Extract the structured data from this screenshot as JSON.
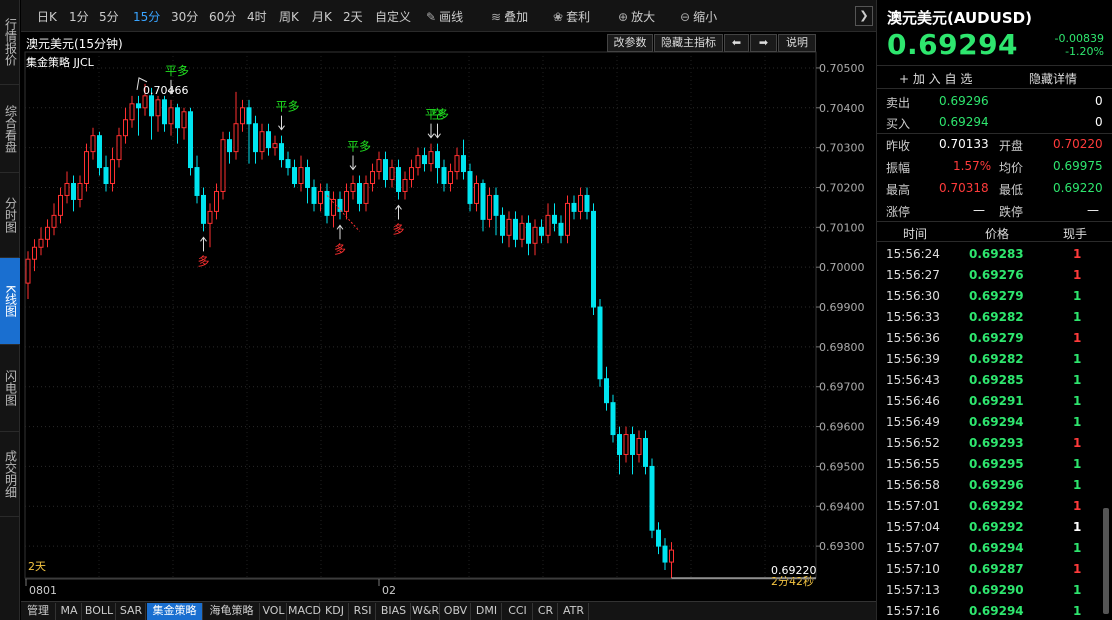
{
  "left_nav": [
    {
      "label": "行情报价",
      "active": false
    },
    {
      "label": "综合看盘",
      "active": false
    },
    {
      "label": "分时图",
      "active": false
    },
    {
      "label": "K线图",
      "active": true
    },
    {
      "label": "闪电图",
      "active": false
    },
    {
      "label": "成交明细",
      "active": false
    }
  ],
  "toolbar": {
    "periods": [
      "日K",
      "1分",
      "5分",
      "15分",
      "30分",
      "60分",
      "4时",
      "周K",
      "月K",
      "2天",
      "自定义"
    ],
    "active_period": "15分",
    "tools": [
      {
        "label": "画线",
        "icon": "pencil-icon",
        "glyph": "✎"
      },
      {
        "label": "叠加",
        "icon": "layers-icon",
        "glyph": "≋"
      },
      {
        "label": "套利",
        "icon": "bag-icon",
        "glyph": "❀"
      },
      {
        "label": "放大",
        "icon": "zoom-in-icon",
        "glyph": "⊕"
      },
      {
        "label": "缩小",
        "icon": "zoom-out-icon",
        "glyph": "⊖"
      }
    ],
    "expand_glyph": "❯"
  },
  "chart_header": {
    "title": "澳元美元(15分钟)",
    "strategy": "集金策略 JJCL",
    "buttons": [
      "改参数",
      "隐藏主指标",
      "⬅",
      "➡",
      "说明"
    ]
  },
  "chart_data": {
    "type": "candlestick",
    "ylim": [
      0.6922,
      0.7054
    ],
    "yticks": [
      "0.70500",
      "0.70400",
      "0.70300",
      "0.70200",
      "0.70100",
      "0.70000",
      "0.69900",
      "0.69800",
      "0.69700",
      "0.69600",
      "0.69500",
      "0.69400",
      "0.69300"
    ],
    "xticks": [
      {
        "label": "0801",
        "index": 0
      },
      {
        "label": "02",
        "index": 54
      }
    ],
    "period_label": "2天",
    "high_label": "0.70466",
    "last_label": "0.69220",
    "countdown_label": "2分42秒",
    "up_color": "#ff3030",
    "down_color": "#00e5f0",
    "signal_color_green": "#20e020",
    "signal_color_red": "#ff3030",
    "candles": [
      [
        0.6996,
        0.7002,
        0.6992,
        0.7004
      ],
      [
        0.7002,
        0.7005,
        0.6999,
        0.7007
      ],
      [
        0.7005,
        0.7007,
        0.7003,
        0.701
      ],
      [
        0.7007,
        0.701,
        0.7005,
        0.7012
      ],
      [
        0.701,
        0.7013,
        0.7008,
        0.7016
      ],
      [
        0.7013,
        0.7018,
        0.7011,
        0.702
      ],
      [
        0.7018,
        0.7021,
        0.7016,
        0.7024
      ],
      [
        0.7021,
        0.7017,
        0.7014,
        0.7023
      ],
      [
        0.7017,
        0.7021,
        0.7015,
        0.7023
      ],
      [
        0.7021,
        0.7029,
        0.7019,
        0.7031
      ],
      [
        0.7029,
        0.7033,
        0.7027,
        0.7035
      ],
      [
        0.7033,
        0.7025,
        0.7023,
        0.7034
      ],
      [
        0.7025,
        0.7021,
        0.7019,
        0.7028
      ],
      [
        0.7021,
        0.7027,
        0.7019,
        0.703
      ],
      [
        0.7027,
        0.7033,
        0.7025,
        0.7035
      ],
      [
        0.7033,
        0.7037,
        0.7031,
        0.704
      ],
      [
        0.7037,
        0.7041,
        0.7035,
        0.7043
      ],
      [
        0.7041,
        0.704,
        0.7033,
        0.7043
      ],
      [
        0.704,
        0.7043,
        0.7038,
        0.7046
      ],
      [
        0.7043,
        0.7038,
        0.7032,
        0.7045
      ],
      [
        0.7038,
        0.7042,
        0.7034,
        0.7043
      ],
      [
        0.7042,
        0.7036,
        0.7034,
        0.7043
      ],
      [
        0.7036,
        0.704,
        0.7033,
        0.7042
      ],
      [
        0.704,
        0.7035,
        0.7031,
        0.7041
      ],
      [
        0.7035,
        0.7039,
        0.7032,
        0.704
      ],
      [
        0.7039,
        0.7025,
        0.7023,
        0.704
      ],
      [
        0.7025,
        0.7018,
        0.7016,
        0.7028
      ],
      [
        0.7018,
        0.7011,
        0.7009,
        0.702
      ],
      [
        0.7011,
        0.7014,
        0.7005,
        0.7016
      ],
      [
        0.7014,
        0.7019,
        0.7012,
        0.7021
      ],
      [
        0.7019,
        0.7032,
        0.7017,
        0.7034
      ],
      [
        0.7032,
        0.7029,
        0.7026,
        0.7034
      ],
      [
        0.7029,
        0.7036,
        0.7027,
        0.7044
      ],
      [
        0.7036,
        0.704,
        0.7034,
        0.7042
      ],
      [
        0.704,
        0.7036,
        0.7026,
        0.7042
      ],
      [
        0.7036,
        0.7029,
        0.7026,
        0.7038
      ],
      [
        0.7029,
        0.7034,
        0.7027,
        0.7036
      ],
      [
        0.7034,
        0.703,
        0.7028,
        0.7036
      ],
      [
        0.703,
        0.7031,
        0.7028,
        0.7033
      ],
      [
        0.7031,
        0.7027,
        0.7025,
        0.7033
      ],
      [
        0.7027,
        0.7025,
        0.7023,
        0.7029
      ],
      [
        0.7025,
        0.7021,
        0.702,
        0.7027
      ],
      [
        0.7021,
        0.7025,
        0.7019,
        0.7028
      ],
      [
        0.7025,
        0.702,
        0.7016,
        0.7027
      ],
      [
        0.702,
        0.7016,
        0.7014,
        0.7022
      ],
      [
        0.7016,
        0.7019,
        0.7014,
        0.7021
      ],
      [
        0.7019,
        0.7013,
        0.7011,
        0.7021
      ],
      [
        0.7013,
        0.7017,
        0.701,
        0.7019
      ],
      [
        0.7017,
        0.7014,
        0.7012,
        0.7019
      ],
      [
        0.7014,
        0.7019,
        0.7012,
        0.7021
      ],
      [
        0.7019,
        0.7021,
        0.7017,
        0.7023
      ],
      [
        0.7021,
        0.7016,
        0.7014,
        0.7023
      ],
      [
        0.7016,
        0.7021,
        0.7014,
        0.7023
      ],
      [
        0.7021,
        0.7024,
        0.7019,
        0.7026
      ],
      [
        0.7024,
        0.7027,
        0.7022,
        0.7029
      ],
      [
        0.7027,
        0.7022,
        0.702,
        0.7029
      ],
      [
        0.7022,
        0.7025,
        0.702,
        0.7027
      ],
      [
        0.7025,
        0.7019,
        0.7017,
        0.7027
      ],
      [
        0.7019,
        0.7022,
        0.7017,
        0.7024
      ],
      [
        0.7022,
        0.7025,
        0.702,
        0.7027
      ],
      [
        0.7025,
        0.7028,
        0.7023,
        0.703
      ],
      [
        0.7028,
        0.7026,
        0.7024,
        0.703
      ],
      [
        0.7026,
        0.7029,
        0.7024,
        0.7031
      ],
      [
        0.7029,
        0.7025,
        0.7021,
        0.7031
      ],
      [
        0.7025,
        0.7021,
        0.7019,
        0.7027
      ],
      [
        0.7021,
        0.7024,
        0.7019,
        0.7026
      ],
      [
        0.7024,
        0.7028,
        0.7022,
        0.703
      ],
      [
        0.7028,
        0.7024,
        0.7022,
        0.7032
      ],
      [
        0.7024,
        0.7016,
        0.7014,
        0.7026
      ],
      [
        0.7016,
        0.7021,
        0.7014,
        0.7023
      ],
      [
        0.7021,
        0.7012,
        0.7009,
        0.7022
      ],
      [
        0.7012,
        0.7018,
        0.701,
        0.702
      ],
      [
        0.7018,
        0.7013,
        0.7008,
        0.702
      ],
      [
        0.7013,
        0.7008,
        0.7006,
        0.7015
      ],
      [
        0.7008,
        0.7012,
        0.7005,
        0.7014
      ],
      [
        0.7012,
        0.7007,
        0.7005,
        0.7014
      ],
      [
        0.7007,
        0.7011,
        0.7005,
        0.7013
      ],
      [
        0.7011,
        0.7006,
        0.7003,
        0.7013
      ],
      [
        0.7006,
        0.701,
        0.7003,
        0.7012
      ],
      [
        0.701,
        0.7008,
        0.7006,
        0.7012
      ],
      [
        0.7008,
        0.7013,
        0.7006,
        0.7016
      ],
      [
        0.7013,
        0.7011,
        0.7009,
        0.7016
      ],
      [
        0.7011,
        0.7008,
        0.7006,
        0.7013
      ],
      [
        0.7008,
        0.7016,
        0.7006,
        0.7018
      ],
      [
        0.7016,
        0.7014,
        0.7012,
        0.7018
      ],
      [
        0.7014,
        0.7018,
        0.7012,
        0.702
      ],
      [
        0.7018,
        0.7014,
        0.7012,
        0.702
      ],
      [
        0.7014,
        0.699,
        0.6988,
        0.7016
      ],
      [
        0.699,
        0.6972,
        0.697,
        0.6992
      ],
      [
        0.6972,
        0.6966,
        0.6964,
        0.6975
      ],
      [
        0.6966,
        0.6958,
        0.6956,
        0.6968
      ],
      [
        0.6958,
        0.6953,
        0.6948,
        0.696
      ],
      [
        0.6953,
        0.6958,
        0.6951,
        0.696
      ],
      [
        0.6958,
        0.6953,
        0.6948,
        0.696
      ],
      [
        0.6953,
        0.6957,
        0.6951,
        0.6959
      ],
      [
        0.6957,
        0.695,
        0.6948,
        0.6959
      ],
      [
        0.695,
        0.6934,
        0.6932,
        0.6952
      ],
      [
        0.6934,
        0.693,
        0.6928,
        0.6936
      ],
      [
        0.693,
        0.6926,
        0.6924,
        0.6932
      ],
      [
        0.6926,
        0.6929,
        0.6922,
        0.6931
      ]
    ],
    "signals": [
      {
        "text": "平多",
        "index": 22,
        "side": "above",
        "color": "green"
      },
      {
        "text": "多",
        "index": 27,
        "side": "below",
        "color": "red"
      },
      {
        "text": "平多",
        "index": 39,
        "side": "above",
        "color": "green"
      },
      {
        "text": "多",
        "index": 48,
        "side": "below",
        "color": "red"
      },
      {
        "text": "平多",
        "index": 50,
        "side": "above",
        "color": "green"
      },
      {
        "text": "多",
        "index": 57,
        "side": "below",
        "color": "red"
      },
      {
        "text": "平多",
        "index": 62,
        "side": "above",
        "color": "green"
      },
      {
        "text": "空",
        "index": 63,
        "side": "above",
        "color": "green"
      }
    ]
  },
  "bottom_tabs": [
    "管理",
    "MA",
    "BOLL",
    "SAR",
    "集金策略",
    "海龟策略",
    "VOL",
    "MACD",
    "KDJ",
    "RSI",
    "BIAS",
    "W&R",
    "OBV",
    "DMI",
    "CCI",
    "CR",
    "ATR"
  ],
  "active_tab": "集金策略",
  "quote": {
    "name": "澳元美元(AUDUSD)",
    "price": "0.69294",
    "arrow": "⬇",
    "change": "-0.00839",
    "change_pct": "-1.20%",
    "add_watch": "+ 加 入 自 选",
    "hide_detail": "隐藏详情",
    "sell_label": "卖出",
    "sell_price": "0.69296",
    "sell_qty": "0",
    "buy_label": "买入",
    "buy_price": "0.69294",
    "buy_qty": "0",
    "prev_close_label": "昨收",
    "prev_close": "0.70133",
    "open_label": "开盘",
    "open": "0.70220",
    "amplitude_label": "振幅",
    "amplitude": "1.57%",
    "avg_label": "均价",
    "avg": "0.69975",
    "high_label": "最高",
    "high": "0.70318",
    "low_label": "最低",
    "low": "0.69220",
    "limit_up_label": "涨停",
    "limit_up": "—",
    "limit_down_label": "跌停",
    "limit_down": "—",
    "col_time": "时间",
    "col_price": "价格",
    "col_vol": "现手"
  },
  "ticks": [
    {
      "time": "15:56:24",
      "price": "0.69283",
      "vol": "1",
      "dir": "down"
    },
    {
      "time": "15:56:27",
      "price": "0.69276",
      "vol": "1",
      "dir": "down"
    },
    {
      "time": "15:56:30",
      "price": "0.69279",
      "vol": "1",
      "dir": "up"
    },
    {
      "time": "15:56:33",
      "price": "0.69282",
      "vol": "1",
      "dir": "up"
    },
    {
      "time": "15:56:36",
      "price": "0.69279",
      "vol": "1",
      "dir": "down"
    },
    {
      "time": "15:56:39",
      "price": "0.69282",
      "vol": "1",
      "dir": "up"
    },
    {
      "time": "15:56:43",
      "price": "0.69285",
      "vol": "1",
      "dir": "up"
    },
    {
      "time": "15:56:46",
      "price": "0.69291",
      "vol": "1",
      "dir": "up"
    },
    {
      "time": "15:56:49",
      "price": "0.69294",
      "vol": "1",
      "dir": "up"
    },
    {
      "time": "15:56:52",
      "price": "0.69293",
      "vol": "1",
      "dir": "down"
    },
    {
      "time": "15:56:55",
      "price": "0.69295",
      "vol": "1",
      "dir": "up"
    },
    {
      "time": "15:56:58",
      "price": "0.69296",
      "vol": "1",
      "dir": "up"
    },
    {
      "time": "15:57:01",
      "price": "0.69292",
      "vol": "1",
      "dir": "down"
    },
    {
      "time": "15:57:04",
      "price": "0.69292",
      "vol": "1",
      "dir": "flat"
    },
    {
      "time": "15:57:07",
      "price": "0.69294",
      "vol": "1",
      "dir": "up"
    },
    {
      "time": "15:57:10",
      "price": "0.69287",
      "vol": "1",
      "dir": "down"
    },
    {
      "time": "15:57:13",
      "price": "0.69290",
      "vol": "1",
      "dir": "up"
    },
    {
      "time": "15:57:16",
      "price": "0.69294",
      "vol": "1",
      "dir": "up"
    }
  ]
}
